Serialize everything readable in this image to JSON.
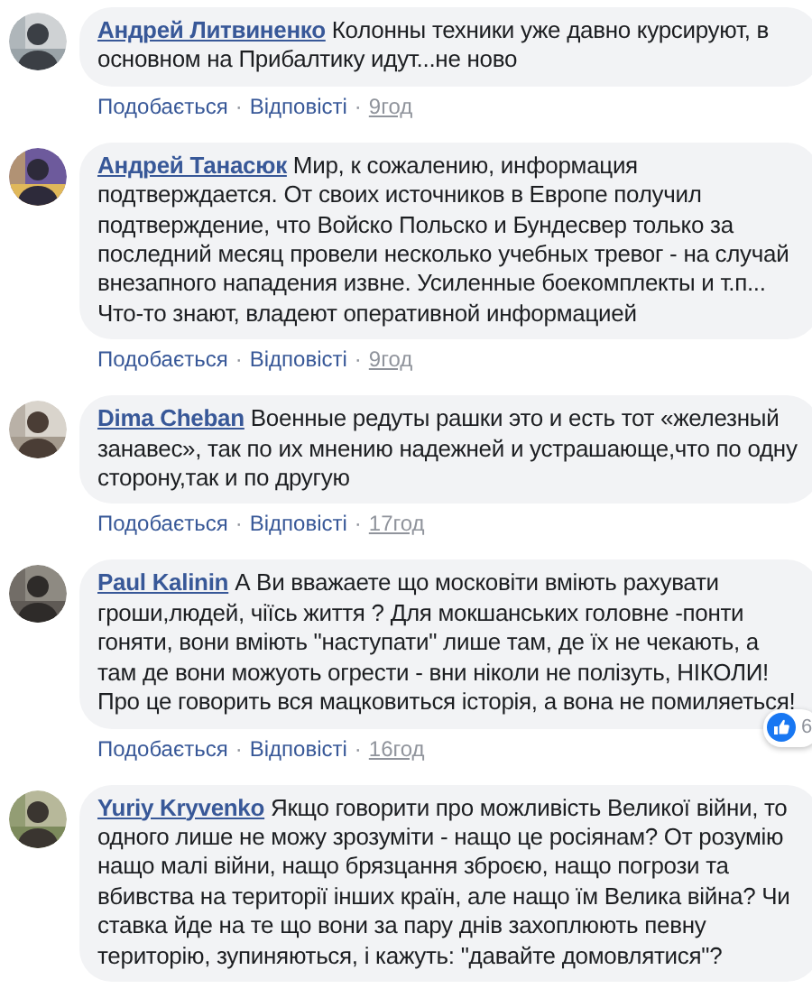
{
  "comments": [
    {
      "author": "Андрей Литвиненко",
      "text": "Колонны техники уже давно курсируют, в основном на Прибалтику идут...не ново",
      "footer": [
        {
          "kind": "link",
          "text": "Подобається"
        },
        {
          "kind": "dot",
          "text": "·"
        },
        {
          "kind": "link",
          "text": "Відповісті"
        },
        {
          "kind": "dot",
          "text": "·"
        },
        {
          "kind": "time",
          "text": "9год"
        }
      ]
    },
    {
      "author": "Андрей Танасюк",
      "text": "Мир, к сожалению, информация подтверждается. От своих источников в Европе получил подтверждение, что Войско Польско и Бундесвер только за последний месяц провели несколько учебных тревог - на случай внезапного нападения извне. Усиленные боекомплекты и т.п... Что-то знают, владеют оперативной информацией",
      "footer": [
        {
          "kind": "link",
          "text": "Подобається"
        },
        {
          "kind": "dot",
          "text": "·"
        },
        {
          "kind": "link",
          "text": "Відповісті"
        },
        {
          "kind": "dot",
          "text": "·"
        },
        {
          "kind": "time",
          "text": "9год"
        }
      ]
    },
    {
      "author": "Dima Cheban",
      "text": "Военные редуты рашки это и есть тот «железный занавес», так по их мнению надежней и устрашающе,что по одну сторону,так и по другую",
      "footer": [
        {
          "kind": "link",
          "text": "Подобається"
        },
        {
          "kind": "dot",
          "text": "·"
        },
        {
          "kind": "link",
          "text": "Відповісті"
        },
        {
          "kind": "dot",
          "text": "·"
        },
        {
          "kind": "time",
          "text": "17год"
        }
      ]
    },
    {
      "author": "Paul Kalinin",
      "text": "А Ви вважаете що московіти вміють рахувати гроши,людей, чiїсь життя ? Для мокшанських головне -понти гоняти, вони вміють \"наступати\" лише там, де їх не чекають, а там де вони можуоть огрести - вни ніколи не полізуть, НІКОЛИ! Про це говорить вся мацковиться історія, а вона не помиляеться!",
      "reactions": {
        "count": "6"
      },
      "footer": [
        {
          "kind": "link",
          "text": "Подобається"
        },
        {
          "kind": "dot",
          "text": "·"
        },
        {
          "kind": "link",
          "text": "Відповісті"
        },
        {
          "kind": "dot",
          "text": "·"
        },
        {
          "kind": "time",
          "text": "16год"
        }
      ]
    },
    {
      "author": "Yuriy Kryvenko",
      "text": "Якщо говорити про можливість Великої війни, то одного лише не можу зрозуміти - нащо це росіянам? От розумію нащо малі війни, нащо брязцання зброєю, нащо погрози та вбивства на території інших країн, але нащо їм Велика війна? Чи ставка йде на те що вони за пару днів захоплюють певну територію, зупиняються, і кажуть: \"давайте домовлятися\"?"
    }
  ]
}
